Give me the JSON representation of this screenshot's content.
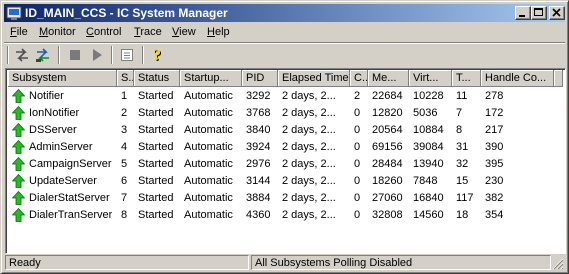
{
  "window": {
    "title": "ID_MAIN_CCS - IC System Manager"
  },
  "menu": [
    {
      "label": "File",
      "key": "F",
      "rest": "ile"
    },
    {
      "label": "Monitor",
      "key": "M",
      "rest": "onitor"
    },
    {
      "label": "Control",
      "key": "C",
      "rest": "ontrol"
    },
    {
      "label": "Trace",
      "key": "T",
      "rest": "race"
    },
    {
      "label": "View",
      "key": "V",
      "rest": "iew"
    },
    {
      "label": "Help",
      "key": "H",
      "rest": "elp"
    }
  ],
  "table": {
    "columns": [
      "Subsystem",
      "S...",
      "Status",
      "Startup...",
      "PID",
      "Elapsed Time",
      "C...",
      "Me...",
      "Virt...",
      "T...",
      "Handle Co..."
    ],
    "rows": [
      [
        "Notifier",
        "1",
        "Started",
        "Automatic",
        "3292",
        "2 days, 2...",
        "2",
        "22684",
        "10228",
        "11",
        "278"
      ],
      [
        "IonNotifier",
        "2",
        "Started",
        "Automatic",
        "3768",
        "2 days, 2...",
        "0",
        "12820",
        "5036",
        "7",
        "172"
      ],
      [
        "DSServer",
        "3",
        "Started",
        "Automatic",
        "3840",
        "2 days, 2...",
        "0",
        "20564",
        "10884",
        "8",
        "217"
      ],
      [
        "AdminServer",
        "4",
        "Started",
        "Automatic",
        "3924",
        "2 days, 2...",
        "0",
        "69156",
        "39084",
        "31",
        "390"
      ],
      [
        "CampaignServer",
        "5",
        "Started",
        "Automatic",
        "2976",
        "2 days, 2...",
        "0",
        "28484",
        "13940",
        "32",
        "395"
      ],
      [
        "UpdateServer",
        "6",
        "Started",
        "Automatic",
        "3144",
        "2 days, 2...",
        "0",
        "18260",
        "7848",
        "15",
        "230"
      ],
      [
        "DialerStatServer",
        "7",
        "Started",
        "Automatic",
        "3884",
        "2 days, 2...",
        "0",
        "27060",
        "16840",
        "117",
        "382"
      ],
      [
        "DialerTranServer",
        "8",
        "Started",
        "Automatic",
        "4360",
        "2 days, 2...",
        "0",
        "32808",
        "14560",
        "18",
        "354"
      ]
    ]
  },
  "status": {
    "left": "Ready",
    "right": "All Subsystems Polling Disabled"
  },
  "colors": {
    "title_start": "#0a246a",
    "title_end": "#a6caf0",
    "row_icon": "#1fbf1f"
  },
  "icons": {
    "row": "green-up-arrow-icon",
    "toolbar": [
      "connect-icon",
      "disconnect-icon",
      "stop-icon",
      "play-icon",
      "properties-icon",
      "help-icon"
    ]
  }
}
